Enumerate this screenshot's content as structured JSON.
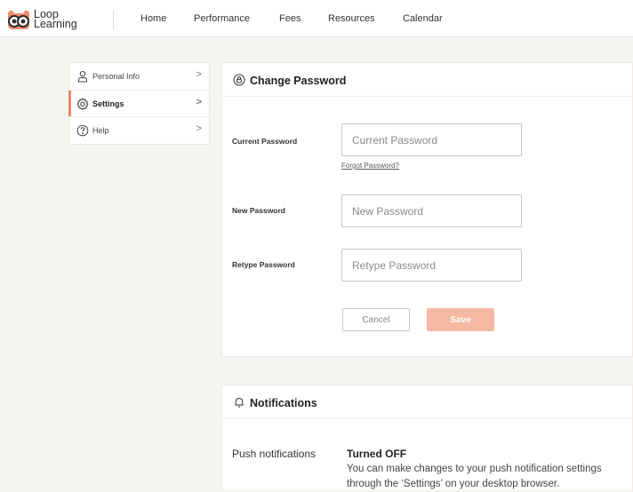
{
  "brand": {
    "line1": "Loop",
    "line2": "Learning"
  },
  "nav": {
    "items": [
      {
        "label": "Home"
      },
      {
        "label": "Performance"
      },
      {
        "label": "Fees"
      },
      {
        "label": "Resources"
      },
      {
        "label": "Calendar"
      }
    ]
  },
  "sidebar": {
    "items": [
      {
        "label": "Personal Info",
        "icon": "user-icon",
        "chevron": ">"
      },
      {
        "label": "Settings",
        "icon": "gear-icon",
        "chevron": ">",
        "active": true
      },
      {
        "label": "Help",
        "icon": "help-icon",
        "chevron": ">"
      }
    ]
  },
  "change_password": {
    "title": "Change Password",
    "icon": "lock-icon",
    "current": {
      "label": "Current Password",
      "placeholder": "Current Password"
    },
    "forgot_link": "Forgot Password?",
    "new": {
      "label": "New Password",
      "placeholder": "New Password"
    },
    "retype": {
      "label": "Retype Password",
      "placeholder": "Retype Password"
    },
    "cancel_label": "Cancel",
    "save_label": "Save"
  },
  "notifications": {
    "title": "Notifications",
    "icon": "bell-icon",
    "push_label": "Push notifications",
    "status": "Turned OFF",
    "description_line1": "You can make changes to your push notification settings",
    "description_line2": "through the ‘Settings’ on your desktop browser."
  },
  "colors": {
    "accent": "#f0886a",
    "save_button": "#f5b9a4",
    "background": "#f7f5f2"
  }
}
